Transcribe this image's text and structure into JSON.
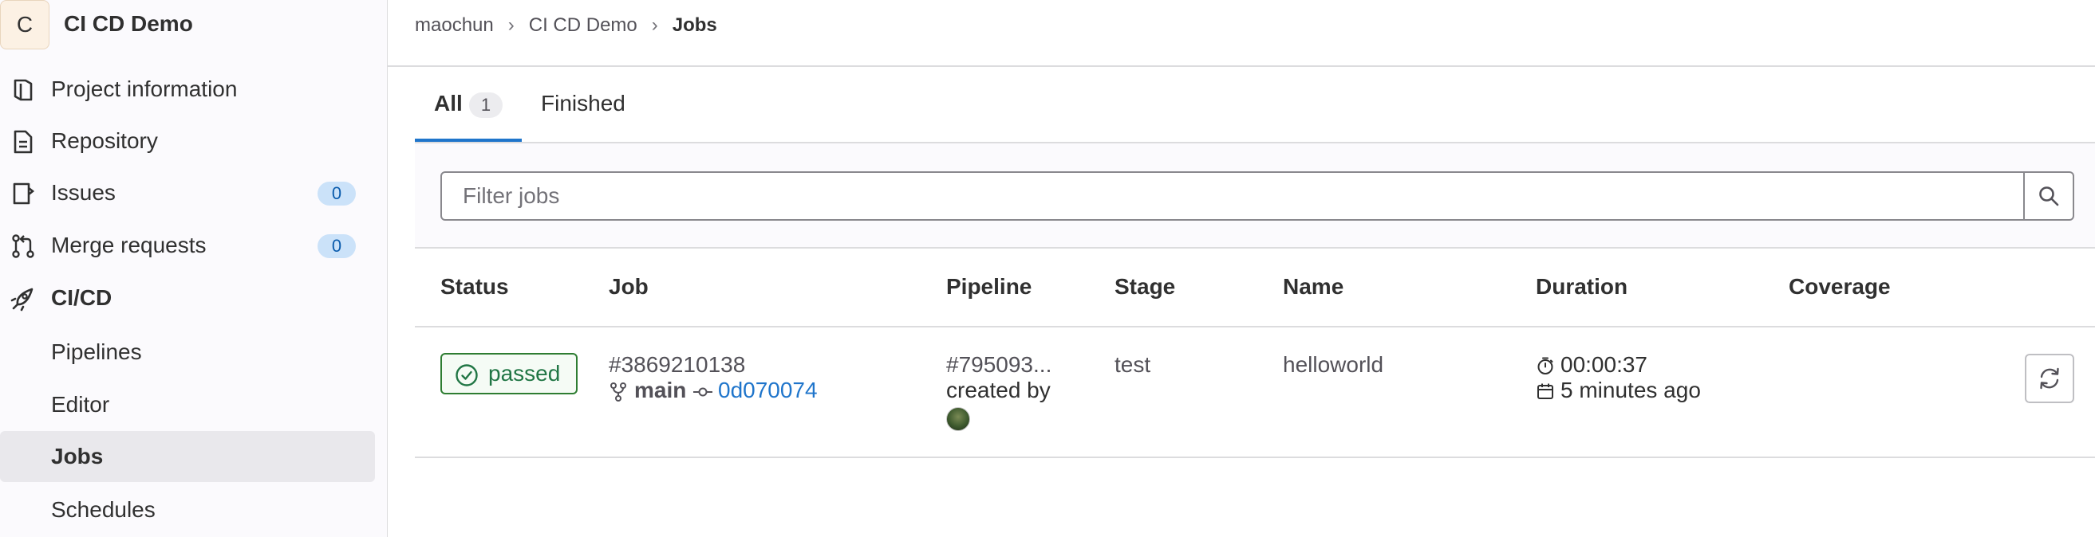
{
  "project": {
    "avatar_letter": "C",
    "name": "CI CD Demo"
  },
  "sidebar": {
    "items": [
      {
        "label": "Project information",
        "icon": "project-info-icon"
      },
      {
        "label": "Repository",
        "icon": "document-icon"
      },
      {
        "label": "Issues",
        "icon": "issues-icon",
        "badge": "0"
      },
      {
        "label": "Merge requests",
        "icon": "merge-request-icon",
        "badge": "0"
      },
      {
        "label": "CI/CD",
        "icon": "rocket-icon"
      }
    ],
    "cicd_subitems": [
      {
        "label": "Pipelines"
      },
      {
        "label": "Editor"
      },
      {
        "label": "Jobs",
        "active": true
      },
      {
        "label": "Schedules"
      }
    ]
  },
  "breadcrumb": {
    "items": [
      "maochun",
      "CI CD Demo",
      "Jobs"
    ],
    "separator": "›"
  },
  "tabs": {
    "all_label": "All",
    "all_count": "1",
    "finished_label": "Finished"
  },
  "filter": {
    "placeholder": "Filter jobs",
    "search_icon": "search-icon"
  },
  "table": {
    "headers": [
      "Status",
      "Job",
      "Pipeline",
      "Stage",
      "Name",
      "Duration",
      "Coverage"
    ],
    "rows": [
      {
        "status": "passed",
        "job_id": "#3869210138",
        "branch": "main",
        "commit": "0d070074",
        "pipeline": "#795093...",
        "created_by": "created by",
        "stage": "test",
        "name": "helloworld",
        "duration": "00:00:37",
        "finished": "5 minutes ago",
        "coverage": ""
      }
    ]
  },
  "colors": {
    "accent": "#1f75cb",
    "success": "#217645",
    "badge_bg": "#cbe2f9"
  }
}
